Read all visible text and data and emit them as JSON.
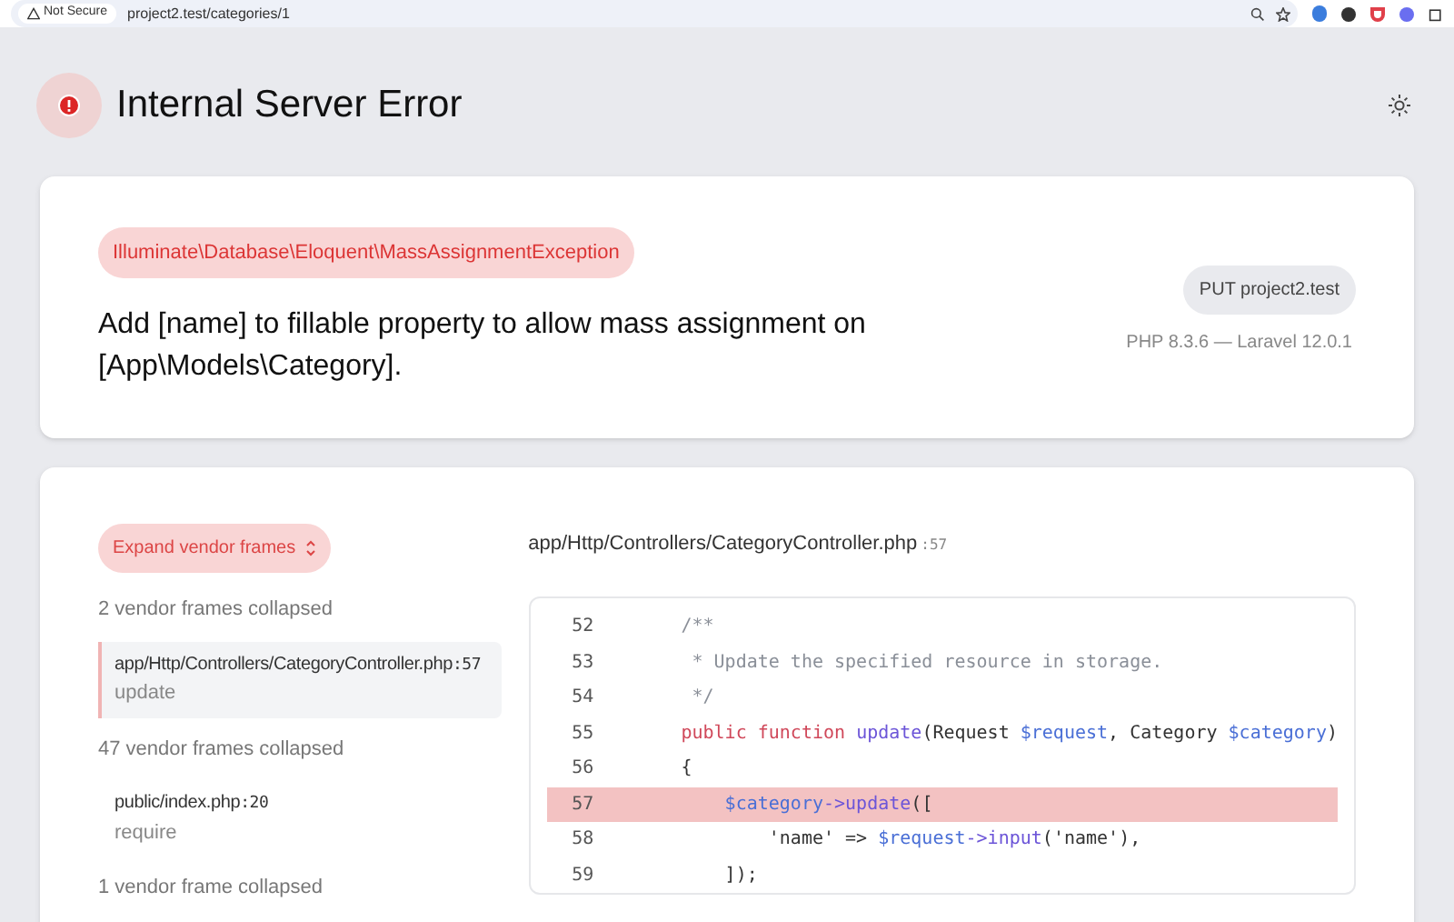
{
  "browser": {
    "security_label": "Not Secure",
    "url": "project2.test/categories/1"
  },
  "header": {
    "title": "Internal Server Error"
  },
  "exception": {
    "class": "Illuminate\\Database\\Eloquent\\MassAssignmentException",
    "message": "Add [name] to fillable property to allow mass assignment on [App\\Models\\Category].",
    "request": "PUT project2.test",
    "versions": "PHP 8.3.6 — Laravel 12.0.1"
  },
  "trace": {
    "expand_button": "Expand vendor frames",
    "frames": [
      {
        "kind": "collapsed",
        "text": "2 vendor frames collapsed"
      },
      {
        "kind": "frame",
        "path": "app/Http/Controllers/CategoryController.php",
        "line": ":57",
        "function": "update",
        "selected": true
      },
      {
        "kind": "collapsed",
        "text": "47 vendor frames collapsed"
      },
      {
        "kind": "frame",
        "path": "public/index.php",
        "line": ":20",
        "function": "require",
        "selected": false
      },
      {
        "kind": "collapsed",
        "text": "1 vendor frame collapsed"
      }
    ]
  },
  "source": {
    "file": "app/Http/Controllers/CategoryController.php",
    "line": ":57",
    "lines": [
      {
        "number": "52",
        "highlighted": false,
        "tokens": [
          {
            "kind": "comment",
            "text": "    /**"
          }
        ]
      },
      {
        "number": "53",
        "highlighted": false,
        "tokens": [
          {
            "kind": "comment",
            "text": "     * Update the specified resource in storage."
          }
        ]
      },
      {
        "number": "54",
        "highlighted": false,
        "tokens": [
          {
            "kind": "comment",
            "text": "     */"
          }
        ]
      },
      {
        "number": "55",
        "highlighted": false,
        "tokens": [
          {
            "kind": "keyword",
            "text": "    public function "
          },
          {
            "kind": "function",
            "text": "update"
          },
          {
            "kind": "plain",
            "text": "(Request "
          },
          {
            "kind": "variable",
            "text": "$request"
          },
          {
            "kind": "plain",
            "text": ", Category "
          },
          {
            "kind": "variable",
            "text": "$category"
          },
          {
            "kind": "plain",
            "text": ")"
          }
        ]
      },
      {
        "number": "56",
        "highlighted": false,
        "tokens": [
          {
            "kind": "plain",
            "text": "    {"
          }
        ]
      },
      {
        "number": "57",
        "highlighted": true,
        "tokens": [
          {
            "kind": "variable",
            "text": "        $category"
          },
          {
            "kind": "function",
            "text": "->update"
          },
          {
            "kind": "plain",
            "text": "(["
          }
        ]
      },
      {
        "number": "58",
        "highlighted": false,
        "tokens": [
          {
            "kind": "plain",
            "text": "            'name' => "
          },
          {
            "kind": "variable",
            "text": "$request"
          },
          {
            "kind": "function",
            "text": "->input"
          },
          {
            "kind": "plain",
            "text": "('name'),"
          }
        ]
      },
      {
        "number": "59",
        "highlighted": false,
        "tokens": [
          {
            "kind": "plain",
            "text": "        ]);"
          }
        ]
      }
    ]
  }
}
